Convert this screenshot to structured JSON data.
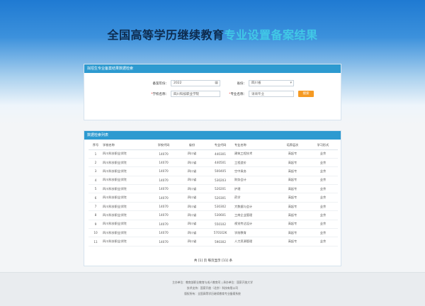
{
  "hero": {
    "title_main": "全国高等学历继续教育",
    "title_accent": "专业设置备案结果"
  },
  "search": {
    "panel_title": "拟招生专业备案结果数据检索",
    "year": {
      "label": "备案年份：",
      "value": "2022"
    },
    "province": {
      "label": "省份：",
      "value": "四川省"
    },
    "school": {
      "label": "学校名称：",
      "value": "四川科技职业学院"
    },
    "major": {
      "label": "专业名称：",
      "placeholder": "请填专业"
    },
    "button_label": "搜索"
  },
  "results": {
    "panel_title": "数据检索列表",
    "columns": [
      "序号",
      "学校名称",
      "学校代码",
      "省份",
      "专业代码",
      "专业名称",
      "培养层次",
      "学习形式"
    ],
    "rows": [
      [
        "1",
        "四川科技职业学院",
        "14070",
        "四川省",
        "440301",
        "建筑工程技术",
        "高起专",
        "业余"
      ],
      [
        "2",
        "四川科技职业学院",
        "14070",
        "四川省",
        "440501",
        "工程造价",
        "高起专",
        "业余"
      ],
      [
        "3",
        "四川科技职业学院",
        "14070",
        "四川省",
        "500405",
        "空中乘务",
        "高起专",
        "业余"
      ],
      [
        "4",
        "四川科技职业学院",
        "14070",
        "四川省",
        "530203",
        "财务会计",
        "高起专",
        "业余"
      ],
      [
        "5",
        "四川科技职业学院",
        "14070",
        "四川省",
        "520201",
        "护理",
        "高起专",
        "业余"
      ],
      [
        "6",
        "四川科技职业学院",
        "14070",
        "四川省",
        "520301",
        "药学",
        "高起专",
        "业余"
      ],
      [
        "7",
        "四川科技职业学院",
        "14070",
        "四川省",
        "530302",
        "大数据与会计",
        "高起专",
        "业余"
      ],
      [
        "8",
        "四川科技职业学院",
        "14070",
        "四川省",
        "530601",
        "工商企业管理",
        "高起专",
        "业余"
      ],
      [
        "9",
        "四川科技职业学院",
        "14070",
        "四川省",
        "550102",
        "视觉传达设计",
        "高起专",
        "业余"
      ],
      [
        "10",
        "四川科技职业学院",
        "14070",
        "四川省",
        "570102K",
        "学前教育",
        "高起专",
        "业余"
      ],
      [
        "11",
        "四川科技职业学院",
        "14070",
        "四川省",
        "590302",
        "人力资源管理",
        "高起专",
        "业余"
      ]
    ],
    "pager": "共 [1] 页 每页显示 [11] 条"
  },
  "footer": {
    "line1": "主办单位：教育部职业教育与成人教育司 | 承办单位：国家开放大学",
    "line2": "技术支持：国家开放（北京）科技有限公司",
    "line3": "版权所有：全国高等学历继续教育专业备案系统"
  }
}
